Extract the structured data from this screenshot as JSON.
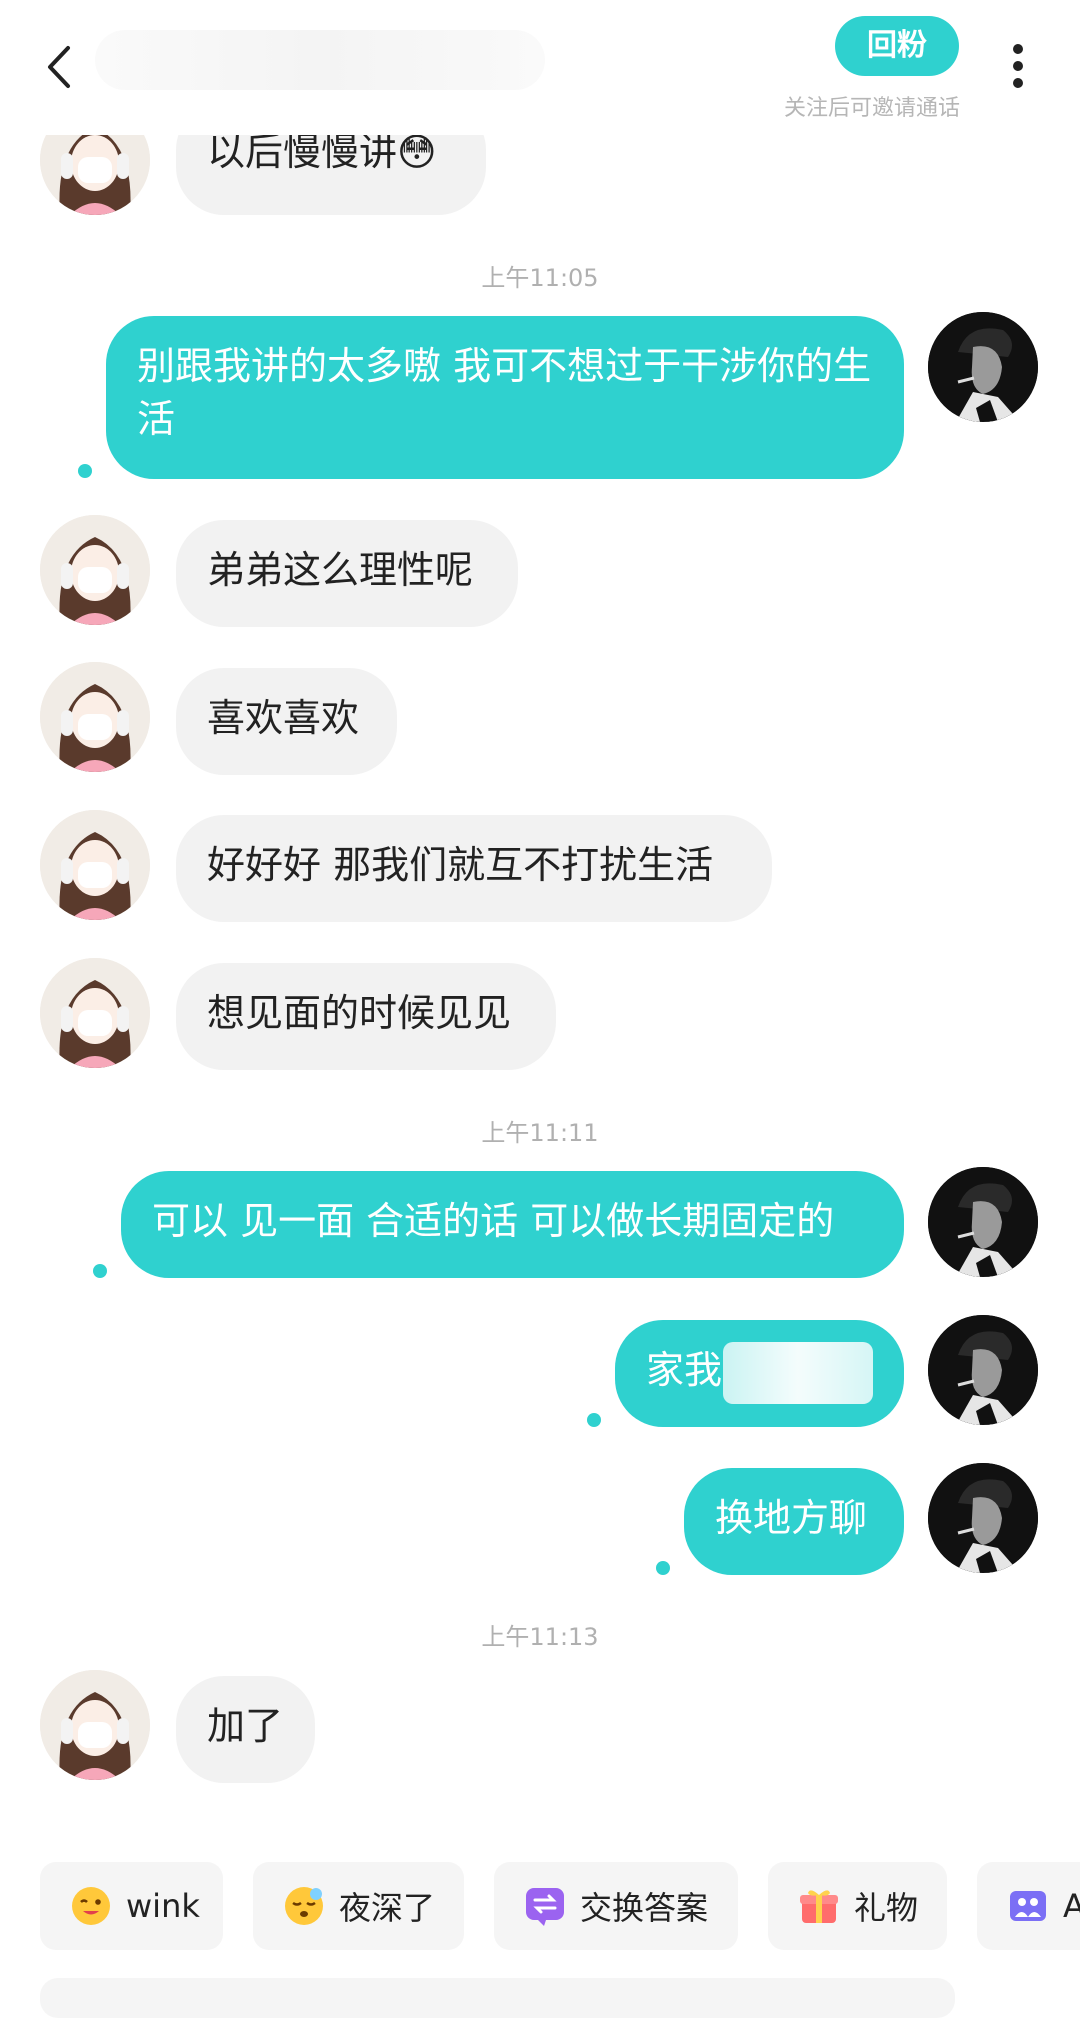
{
  "header": {
    "follow_label": "回粉",
    "follow_hint": "关注后可邀请通话"
  },
  "messages": [
    {
      "type": "text",
      "from": "her",
      "text": "以后慢慢讲😳"
    },
    {
      "type": "time",
      "text": "上午11:05"
    },
    {
      "type": "text",
      "from": "me",
      "text": "别跟我讲的太多嗷 我可不想过于干涉你的生活"
    },
    {
      "type": "text",
      "from": "her",
      "text": "弟弟这么理性呢"
    },
    {
      "type": "text",
      "from": "her",
      "text": "喜欢喜欢"
    },
    {
      "type": "text",
      "from": "her",
      "text": "好好好 那我们就互不打扰生活"
    },
    {
      "type": "text",
      "from": "her",
      "text": "想见面的时候见见"
    },
    {
      "type": "time",
      "text": "上午11:11"
    },
    {
      "type": "text",
      "from": "me",
      "text": "可以 见一面 合适的话 可以做长期固定的"
    },
    {
      "type": "text",
      "from": "me",
      "text": "家我"
    },
    {
      "type": "text",
      "from": "me",
      "text": "换地方聊"
    },
    {
      "type": "time",
      "text": "上午11:13"
    },
    {
      "type": "text",
      "from": "her",
      "text": "加了"
    }
  ],
  "quick_actions": [
    {
      "label": "wink",
      "icon": "wink-emoji-icon"
    },
    {
      "label": "夜深了",
      "icon": "sleepy-emoji-icon"
    },
    {
      "label": "交换答案",
      "icon": "exchange-icon"
    },
    {
      "label": "礼物",
      "icon": "gift-icon"
    },
    {
      "label": "A",
      "icon": "album-icon"
    }
  ],
  "colors": {
    "accent": "#2fd1cf",
    "incoming_bubble": "#f2f2f2",
    "timestamp": "#b0b0b0"
  }
}
